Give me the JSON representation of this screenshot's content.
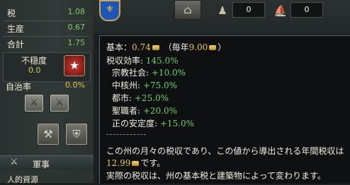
{
  "province_panel": {
    "tax_label": "税",
    "tax_value": "1.08",
    "production_label": "生産",
    "production_value": "0.67",
    "total_label": "合計",
    "total_value": "1.75",
    "unrest_label": "不穏度",
    "unrest_value": "0.0",
    "autonomy_label": "自治率",
    "autonomy_value": "0.0%"
  },
  "military_tab": {
    "label": "軍事"
  },
  "bottom_tab": {
    "label": "人的資源"
  },
  "top_bar": {
    "resource_1_value": "0",
    "resource_2_value": "0"
  },
  "tooltip": {
    "base_prefix": "基本：",
    "base_value": "0.74",
    "yearly_prefix": "（毎年",
    "yearly_value": "9.00",
    "yearly_suffix": "）",
    "efficiency_label": "税収効率:",
    "efficiency_value": "145.0%",
    "modifiers": [
      {
        "label": "宗教社会:",
        "value": "+10.0%"
      },
      {
        "label": "中核州:",
        "value": "+75.0%"
      },
      {
        "label": "都市:",
        "value": "+25.0%"
      },
      {
        "label": "聖職者:",
        "value": "+20.0%"
      },
      {
        "label": "正の安定度:",
        "value": "+15.0%"
      }
    ],
    "description_line1": "この州の月々の税収であり、この値から導出される年間税収は",
    "description_value": "12.99",
    "description_line2_suffix": "です。",
    "description_line3": "実際の税収は、州の基本税と建築物によって変わります。"
  },
  "colors": {
    "positive": "#6fd26a",
    "highlight": "#e9c94a",
    "text": "#f2eee2"
  },
  "icons": {
    "crest": "country-crest-icon",
    "unrest": "unrest-star-icon",
    "merchants": "merchants-icon",
    "ships": "ship-icon"
  }
}
